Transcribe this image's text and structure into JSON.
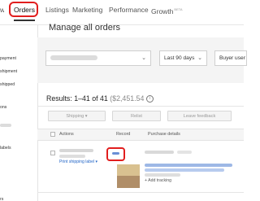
{
  "nav": {
    "cut_label": "w",
    "tabs": [
      "Orders",
      "Listings",
      "Marketing",
      "Performance",
      "Growth"
    ],
    "growth_badge": "BETA"
  },
  "sidebar": {
    "items": [
      "payment",
      "shipment",
      "shipped",
      "ons",
      "labels",
      "rs"
    ]
  },
  "page": {
    "title": "Manage all orders"
  },
  "filters": {
    "period": "Last 90 days",
    "buyer": "Buyer user"
  },
  "results": {
    "label": "Results: 1–41 of 41",
    "total": "($2,451.54",
    "info_icon": "info-icon"
  },
  "actions": {
    "shipping": "Shipping",
    "shipping_chevron": "▾",
    "relist": "Relist",
    "feedback": "Leave feedback"
  },
  "table": {
    "columns": [
      "Actions",
      "Record",
      "Purchase details"
    ],
    "row": {
      "print_label": "Print shipping label",
      "print_chevron": "▾",
      "add_tracking": "+ Add tracking",
      "record_icon": "record-link"
    }
  },
  "colors": {
    "highlight": "#e11e1e",
    "link": "#1f63c6",
    "filter_bg": "#f4f4f4"
  }
}
